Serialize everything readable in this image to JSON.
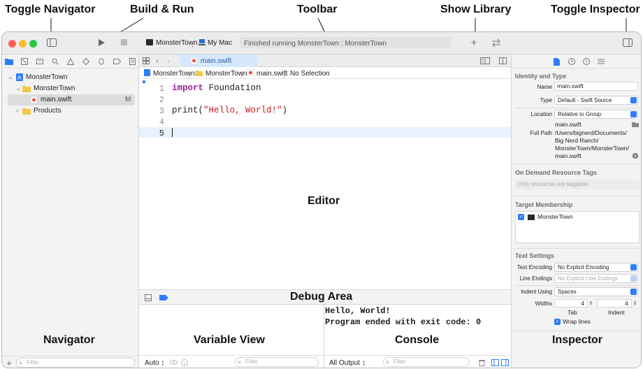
{
  "callouts": {
    "toggle_navigator": "Toggle Navigator",
    "build_run": "Build & Run",
    "toolbar": "Toolbar",
    "show_library": "Show Library",
    "toggle_inspector": "Toggle Inspector"
  },
  "regions": {
    "editor": "Editor",
    "debug_area": "Debug Area",
    "navigator": "Navigator",
    "variable_view": "Variable View",
    "console": "Console",
    "inspector": "Inspector"
  },
  "toolbar": {
    "scheme": "MonsterTown",
    "destination": "My Mac",
    "status": "Finished running MonsterTown : MonsterTown"
  },
  "tab": {
    "label": "main.swift"
  },
  "jumpbar": [
    "MonsterTown",
    "MonsterTown",
    "main.swift",
    "No Selection"
  ],
  "navigator": {
    "project": "MonsterTown",
    "group": "MonsterTown",
    "file": "main.swift",
    "file_badge": "M",
    "products": "Products",
    "filter_placeholder": "Filter"
  },
  "editor": {
    "line_numbers": [
      "1",
      "2",
      "3",
      "4",
      "5"
    ],
    "line1_kw": "import",
    "line1_rest": " Foundation",
    "line3_fn": "print(",
    "line3_str": "\"Hello, World!\"",
    "line3_end": ")"
  },
  "console": {
    "line1": "Hello, World!",
    "line2": "Program ended with exit code: 0",
    "output_select": "All Output ↕",
    "filter_placeholder": "Filter"
  },
  "variables": {
    "auto_select": "Auto ↕",
    "filter_placeholder": "Filter"
  },
  "inspector": {
    "identity_title": "Identity and Type",
    "name_label": "Name",
    "name_value": "main.swift",
    "type_label": "Type",
    "type_value": "Default - Swift Source",
    "location_label": "Location",
    "location_value": "Relative to Group",
    "location_file": "main.swift",
    "fullpath_label": "Full Path",
    "fullpath_lines": [
      "/Users/bignerd/Documents/",
      "Big Nerd Ranch/",
      "MonsterTown/MonsterTown/",
      "main.swift"
    ],
    "odr_title": "On Demand Resource Tags",
    "odr_placeholder": "Only resources are taggable",
    "target_title": "Target Membership",
    "target_item": "MonsterTown",
    "text_title": "Text Settings",
    "encoding_label": "Text Encoding",
    "encoding_value": "No Explicit Encoding",
    "endings_label": "Line Endings",
    "endings_value": "No Explicit Line Endings",
    "indent_label": "Indent Using",
    "indent_value": "Spaces",
    "widths_label": "Widths",
    "tab_value": "4",
    "indent_width_value": "4",
    "tab_caption": "Tab",
    "indent_caption": "Indent",
    "wrap_label": "Wrap lines"
  }
}
